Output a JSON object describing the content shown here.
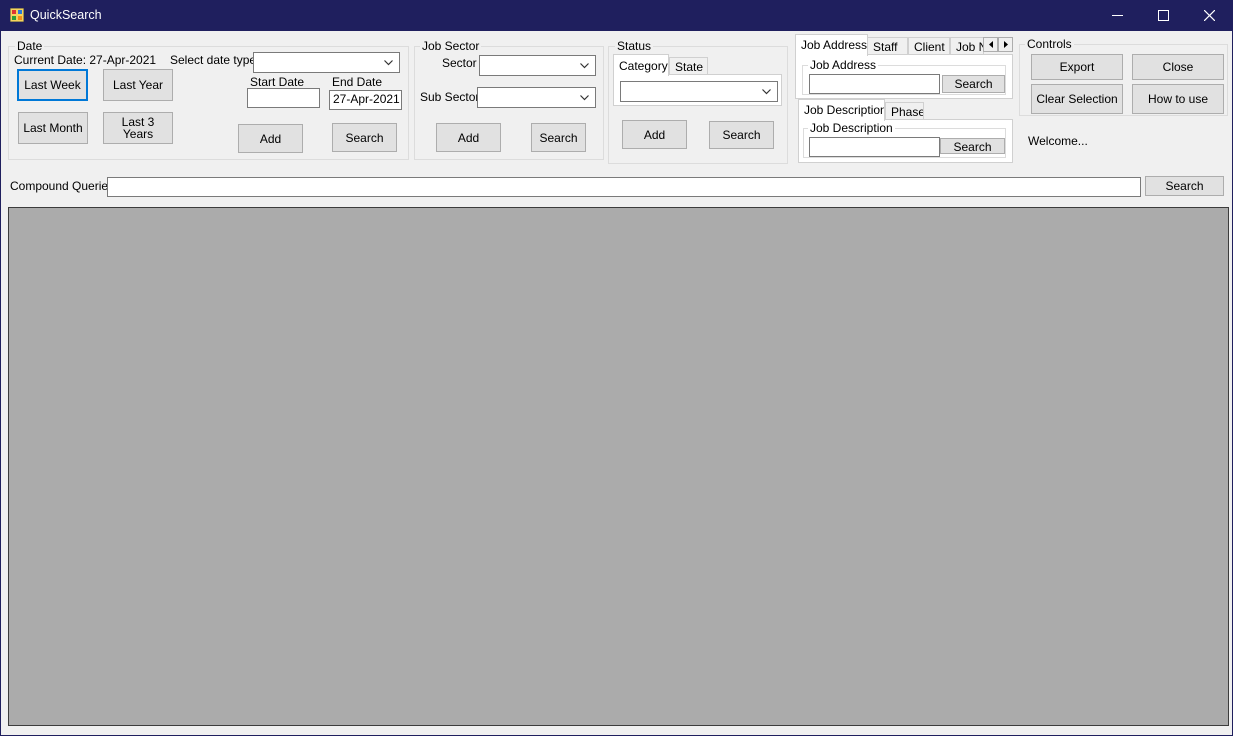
{
  "window": {
    "title": "QuickSearch",
    "controls": [
      "minimize-icon",
      "maximize-icon",
      "close-icon"
    ]
  },
  "date_group": {
    "title": "Date",
    "current_date": "Current Date: 27-Apr-2021",
    "select_date_type_label": "Select date type",
    "date_type_value": "",
    "buttons": {
      "last_week": "Last Week",
      "last_year": "Last Year",
      "last_month": "Last Month",
      "last_3_years": "Last 3 Years"
    },
    "start_date_label": "Start Date",
    "start_date_value": "",
    "end_date_label": "End Date",
    "end_date_value": "27-Apr-2021",
    "add_label": "Add",
    "search_label": "Search"
  },
  "job_sector_group": {
    "title": "Job Sector",
    "sector_label": "Sector",
    "sector_value": "",
    "sub_sector_label": "Sub Sector",
    "sub_sector_value": "",
    "add_label": "Add",
    "search_label": "Search"
  },
  "status_group": {
    "title": "Status",
    "tabs": [
      "Category",
      "State"
    ],
    "category_value": "",
    "add_label": "Add",
    "search_label": "Search"
  },
  "job_tabs": {
    "tabs": [
      "Job Address",
      "Staff",
      "Client",
      "Job N"
    ],
    "inner_group_title": "Job Address",
    "input_value": "",
    "search_label": "Search"
  },
  "desc_tabs": {
    "tabs": [
      "Job Description",
      "Phase"
    ],
    "inner_group_title": "Job Description",
    "input_value": "",
    "search_label": "Search"
  },
  "controls_group": {
    "title": "Controls",
    "export_label": "Export",
    "close_label": "Close",
    "clear_selection_label": "Clear Selection",
    "how_to_use_label": "How to use"
  },
  "welcome_text": "Welcome...",
  "compound": {
    "label": "Compound Queries",
    "value": "",
    "search_label": "Search"
  },
  "colors": {
    "title_bar": "#1f1f5e",
    "focus_border": "#0078d7",
    "grid_background": "#ababab"
  }
}
